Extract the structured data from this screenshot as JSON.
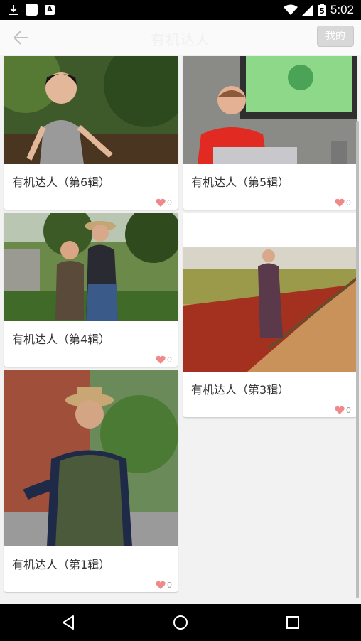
{
  "status_bar": {
    "time": "5:02",
    "battery_level": "5"
  },
  "top_bar": {
    "title": "有机达人",
    "mine_label": "我的"
  },
  "cards": [
    {
      "title": "有机达人（第6辑）",
      "likes": "0"
    },
    {
      "title": "有机达人（第5辑）",
      "likes": "0"
    },
    {
      "title": "有机达人（第4辑）",
      "likes": "0"
    },
    {
      "title": "有机达人（第3辑）",
      "likes": "0"
    },
    {
      "title": "有机达人（第1辑）",
      "likes": "0"
    }
  ],
  "colors": {
    "heart": "#f08a8a",
    "status_bar": "#000000",
    "nav_bar": "#000000"
  },
  "icons": [
    "download-icon",
    "app-square-icon",
    "a-icon",
    "wifi-icon",
    "signal-icon",
    "battery-icon",
    "back-arrow-icon",
    "heart-icon",
    "nav-back-icon",
    "nav-home-icon",
    "nav-recents-icon"
  ]
}
